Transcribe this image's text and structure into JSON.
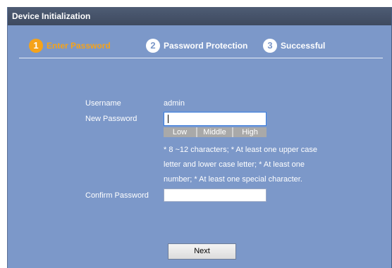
{
  "window": {
    "title": "Device Initialization"
  },
  "steps": [
    {
      "number": "1",
      "label": "Enter Password",
      "active": true
    },
    {
      "number": "2",
      "label": "Password Protection",
      "active": false
    },
    {
      "number": "3",
      "label": "Successful",
      "active": false
    }
  ],
  "form": {
    "username_label": "Username",
    "username_value": "admin",
    "new_password_label": "New Password",
    "new_password_value": "",
    "strength_levels": [
      "Low",
      "Middle",
      "High"
    ],
    "rules": [
      "* 8 ~12 characters; * At least one upper case",
      "letter and lower case letter; * At least one",
      "number; * At least one special character."
    ],
    "confirm_password_label": "Confirm Password",
    "confirm_password_value": ""
  },
  "actions": {
    "next_label": "Next"
  },
  "colors": {
    "panel": "#7c98c9",
    "titlebar": "#3e4a5f",
    "active_step": "#f5a31a",
    "text": "#ffffff"
  }
}
